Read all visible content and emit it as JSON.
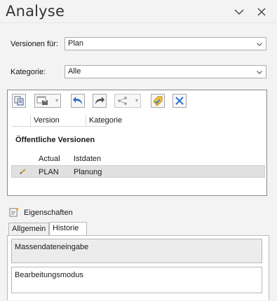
{
  "window": {
    "title": "Analyse"
  },
  "form": {
    "versionen_label": "Versionen für:",
    "versionen_value": "Plan",
    "kategorie_label": "Kategorie:",
    "kategorie_value": "Alle"
  },
  "versions_table": {
    "columns": [
      "Version",
      "Kategorie"
    ],
    "group_title": "Öffentliche Versionen",
    "row_header": {
      "version": "Actual",
      "kategorie": "Istdaten"
    },
    "rows": [
      {
        "version": "PLAN",
        "kategorie": "Planung",
        "selected": true
      }
    ]
  },
  "properties": {
    "title": "Eigenschaften",
    "tabs": [
      "Allgemein",
      "Historie"
    ],
    "active_tab": "Historie",
    "field1": "Massendateneingabe",
    "field2": "Bearbeitungsmodus"
  },
  "colors": {
    "selected_row": "#e0e0e0",
    "accent_blue": "#2a72c4",
    "border": "#8a8a8a"
  }
}
